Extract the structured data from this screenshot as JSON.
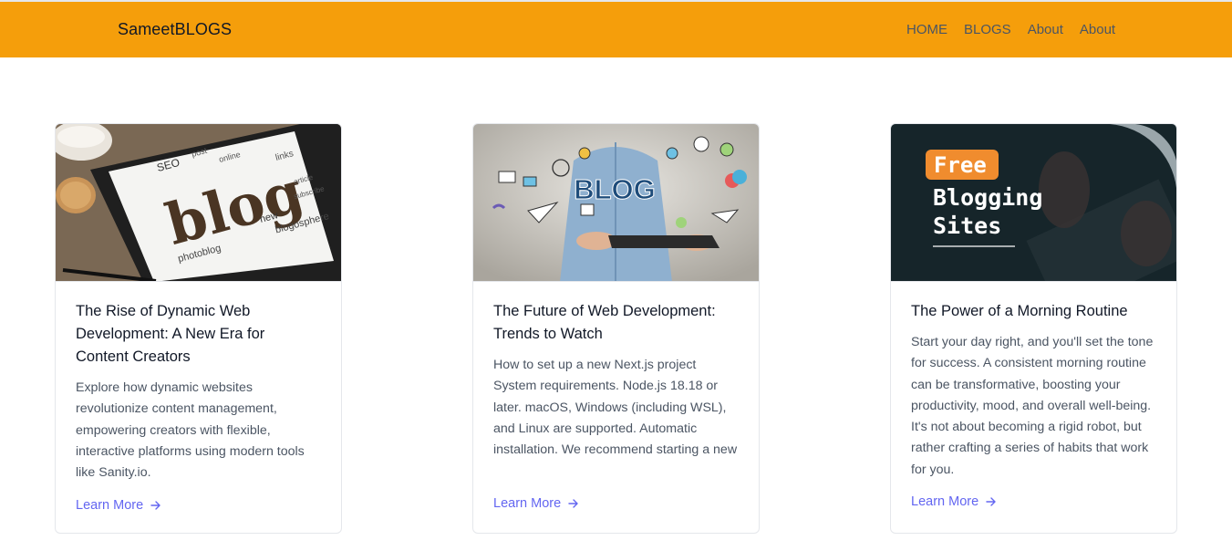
{
  "header": {
    "brand": "SameetBLOGS",
    "nav": [
      "HOME",
      "BLOGS",
      "About",
      "About"
    ],
    "background": "#f59e0b"
  },
  "cards": [
    {
      "image_icon": "blog-word-cloud-tablet-image",
      "image_words": [
        "blog",
        "SEO",
        "photoblog",
        "blogosphere",
        "new",
        "online",
        "links",
        "post",
        "subscribe",
        "article"
      ],
      "title": "The Rise of Dynamic Web Development: A New Era for Content Creators",
      "excerpt": "Explore how dynamic websites revolutionize content management, empowering creators with flexible, interactive platforms using modern tools like Sanity.io.",
      "link": "Learn More"
    },
    {
      "image_icon": "man-holding-tablet-blog-image",
      "image_words": [
        "BLOG"
      ],
      "title": "The Future of Web Development: Trends to Watch",
      "excerpt": "How to set up a new Next.js project System requirements. Node.js 18.18 or later. macOS, Windows (including WSL), and Linux are supported. Automatic installation. We recommend starting a new",
      "link": "Learn More"
    },
    {
      "image_icon": "free-blogging-sites-image",
      "image_words": [
        "Free",
        "Blogging",
        "Sites"
      ],
      "title": "The Power of a Morning Routine",
      "excerpt": "Start your day right, and you'll set the tone for success. A consistent morning routine can be transformative, boosting your productivity, mood, and overall well-being. It's not about becoming a rigid robot, but rather crafting a series of habits that work for you.",
      "link": "Learn More"
    }
  ],
  "colors": {
    "accent": "#6366f1",
    "orange": "#f59e0b"
  }
}
